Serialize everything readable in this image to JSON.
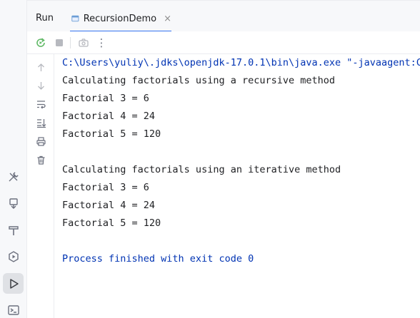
{
  "header": {
    "panel_title": "Run",
    "tab_label": "RecursionDemo",
    "tab_close": "×"
  },
  "toolbar": {
    "icons": [
      "rerun-icon",
      "stop-icon",
      "camera-icon",
      "more-icon"
    ],
    "more_label": "⋮"
  },
  "console_actions": [
    "up-arrow-icon",
    "down-arrow-icon",
    "soft-wrap-icon",
    "scroll-to-end-icon",
    "print-icon",
    "trash-icon"
  ],
  "left_stripe": [
    "build-icon",
    "debug-step-icon",
    "hammer-icon",
    "services-icon",
    "run-icon",
    "terminal-icon"
  ],
  "console": {
    "command": "C:\\Users\\yuliy\\.jdks\\openjdk-17.0.1\\bin\\java.exe \"-javaagent:C:",
    "lines": [
      "Calculating factorials using a recursive method",
      "Factorial 3 = 6",
      "Factorial 4 = 24",
      "Factorial 5 = 120",
      "",
      "Calculating factorials using an iterative method",
      "Factorial 3 = 6",
      "Factorial 4 = 24",
      "Factorial 5 = 120",
      ""
    ],
    "exit_message": "Process finished with exit code 0"
  },
  "colors": {
    "accent": "#3574f0",
    "command_text": "#0033b3",
    "rerun_green": "#5fb865"
  }
}
